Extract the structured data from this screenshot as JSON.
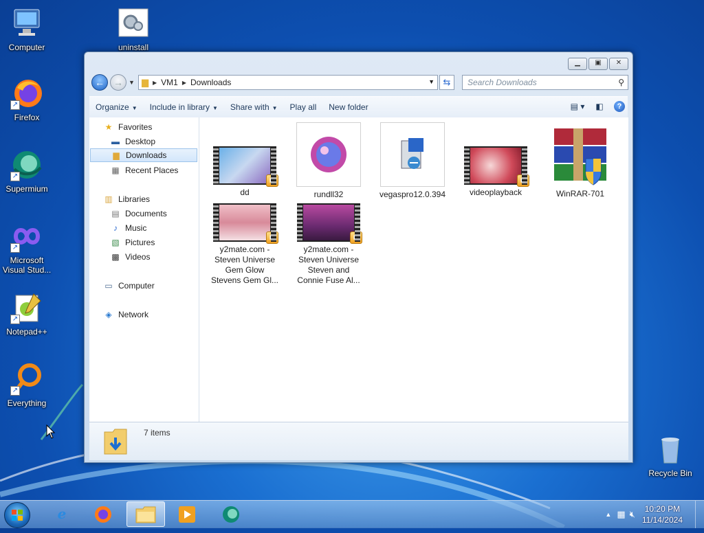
{
  "desktop": {
    "icons": [
      {
        "label": "Computer",
        "icon": "computer-icon"
      },
      {
        "label": "uninstall",
        "icon": "uninstall-icon"
      },
      {
        "label": "Firefox",
        "icon": "firefox-icon"
      },
      {
        "label": "Supermium",
        "icon": "supermium-icon"
      },
      {
        "label": "Microsoft Visual Stud...",
        "label_line1": "Microsoft",
        "label_line2": "Visual Stud...",
        "icon": "visual-studio-icon"
      },
      {
        "label": "Notepad++",
        "icon": "notepadpp-icon"
      },
      {
        "label": "Everything",
        "icon": "everything-icon"
      },
      {
        "label": "Recycle Bin",
        "icon": "recycle-bin-icon"
      }
    ]
  },
  "explorer": {
    "address": {
      "root": "VM1",
      "current": "Downloads"
    },
    "search_placeholder": "Search Downloads",
    "toolbar": {
      "organize": "Organize",
      "include": "Include in library",
      "share": "Share with",
      "play": "Play all",
      "new_folder": "New folder"
    },
    "nav": {
      "favorites": "Favorites",
      "desktop": "Desktop",
      "downloads": "Downloads",
      "recent": "Recent Places",
      "libraries": "Libraries",
      "documents": "Documents",
      "music": "Music",
      "pictures": "Pictures",
      "videos": "Videos",
      "computer": "Computer",
      "network": "Network"
    },
    "files": [
      {
        "name": "dd",
        "type": "video"
      },
      {
        "name": "rundll32",
        "type": "image"
      },
      {
        "name": "vegaspro12.0.394",
        "type": "installer"
      },
      {
        "name": "videoplayback",
        "type": "video"
      },
      {
        "name": "WinRAR-701",
        "type": "archive-installer"
      },
      {
        "name_lines": [
          "y2mate.com -",
          "Steven Universe",
          "Gem Glow",
          "Stevens Gem Gl..."
        ],
        "type": "video"
      },
      {
        "name_lines": [
          "y2mate.com -",
          "Steven Universe",
          "Steven and",
          "Connie Fuse Al..."
        ],
        "type": "video"
      }
    ],
    "status": {
      "count": "7 items"
    }
  },
  "taskbar": {
    "time": "10:20 PM",
    "date": "11/14/2024"
  },
  "colors": {
    "accent": "#1d63c6",
    "toolbar_text": "#1e395b"
  }
}
